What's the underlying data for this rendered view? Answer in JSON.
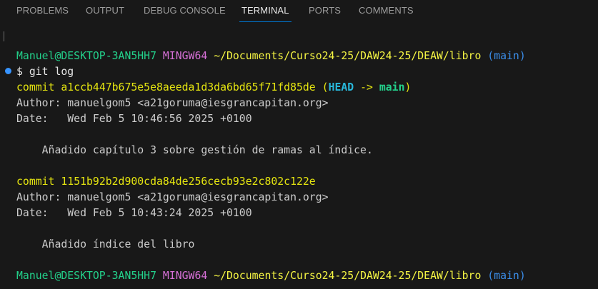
{
  "panel_tabs": [
    {
      "label": "PROBLEMS",
      "active": false
    },
    {
      "label": "OUTPUT",
      "active": false
    },
    {
      "label": "DEBUG CONSOLE",
      "active": false
    },
    {
      "label": "TERMINAL",
      "active": true
    },
    {
      "label": "PORTS",
      "active": false
    },
    {
      "label": "COMMENTS",
      "active": false
    }
  ],
  "terminal": {
    "prompt1": {
      "user_host": "Manuel@DESKTOP-3AN5HH7",
      "env": "MINGW64",
      "path": "~/Documents/Curso24-25/DAW24-25/DEAW/libro",
      "branch": "(main)"
    },
    "command": "$ git log",
    "commit1": {
      "keyword": "commit",
      "hash": "a1ccb447b675e5e8aeeda1d3da6bd65f71fd85de",
      "ref_open": "(",
      "ref_head": "HEAD",
      "ref_arrow": " -> ",
      "ref_branch": "main",
      "ref_close": ")",
      "author": "Author: manuelgom5 <a21goruma@iesgrancapitan.org>",
      "date": "Date:   Wed Feb 5 10:46:56 2025 +0100",
      "message": "    Añadido capítulo 3 sobre gestión de ramas al índice."
    },
    "commit2": {
      "keyword": "commit",
      "hash": "1151b92b2d900cda84de256cecb93e2c802c122e",
      "author": "Author: manuelgom5 <a21goruma@iesgrancapitan.org>",
      "date": "Date:   Wed Feb 5 10:43:24 2025 +0100",
      "message": "    Añadido índice del libro"
    },
    "prompt2": {
      "user_host": "Manuel@DESKTOP-3AN5HH7",
      "env": "MINGW64",
      "path": "~/Documents/Curso24-25/DAW24-25/DEAW/libro",
      "branch": "(main)"
    }
  },
  "colors": {
    "background": "#181818",
    "tab_active_underline": "#0078d4",
    "prompt_user": "#23d18b",
    "prompt_env": "#d670d6",
    "prompt_path": "#f5f543",
    "prompt_branch": "#3b8eea",
    "commit_hash": "#e5e510",
    "ref_head": "#29b8db",
    "ref_branch": "#23d18b",
    "text": "#cccccc",
    "command_decoration": "#3794ff"
  }
}
